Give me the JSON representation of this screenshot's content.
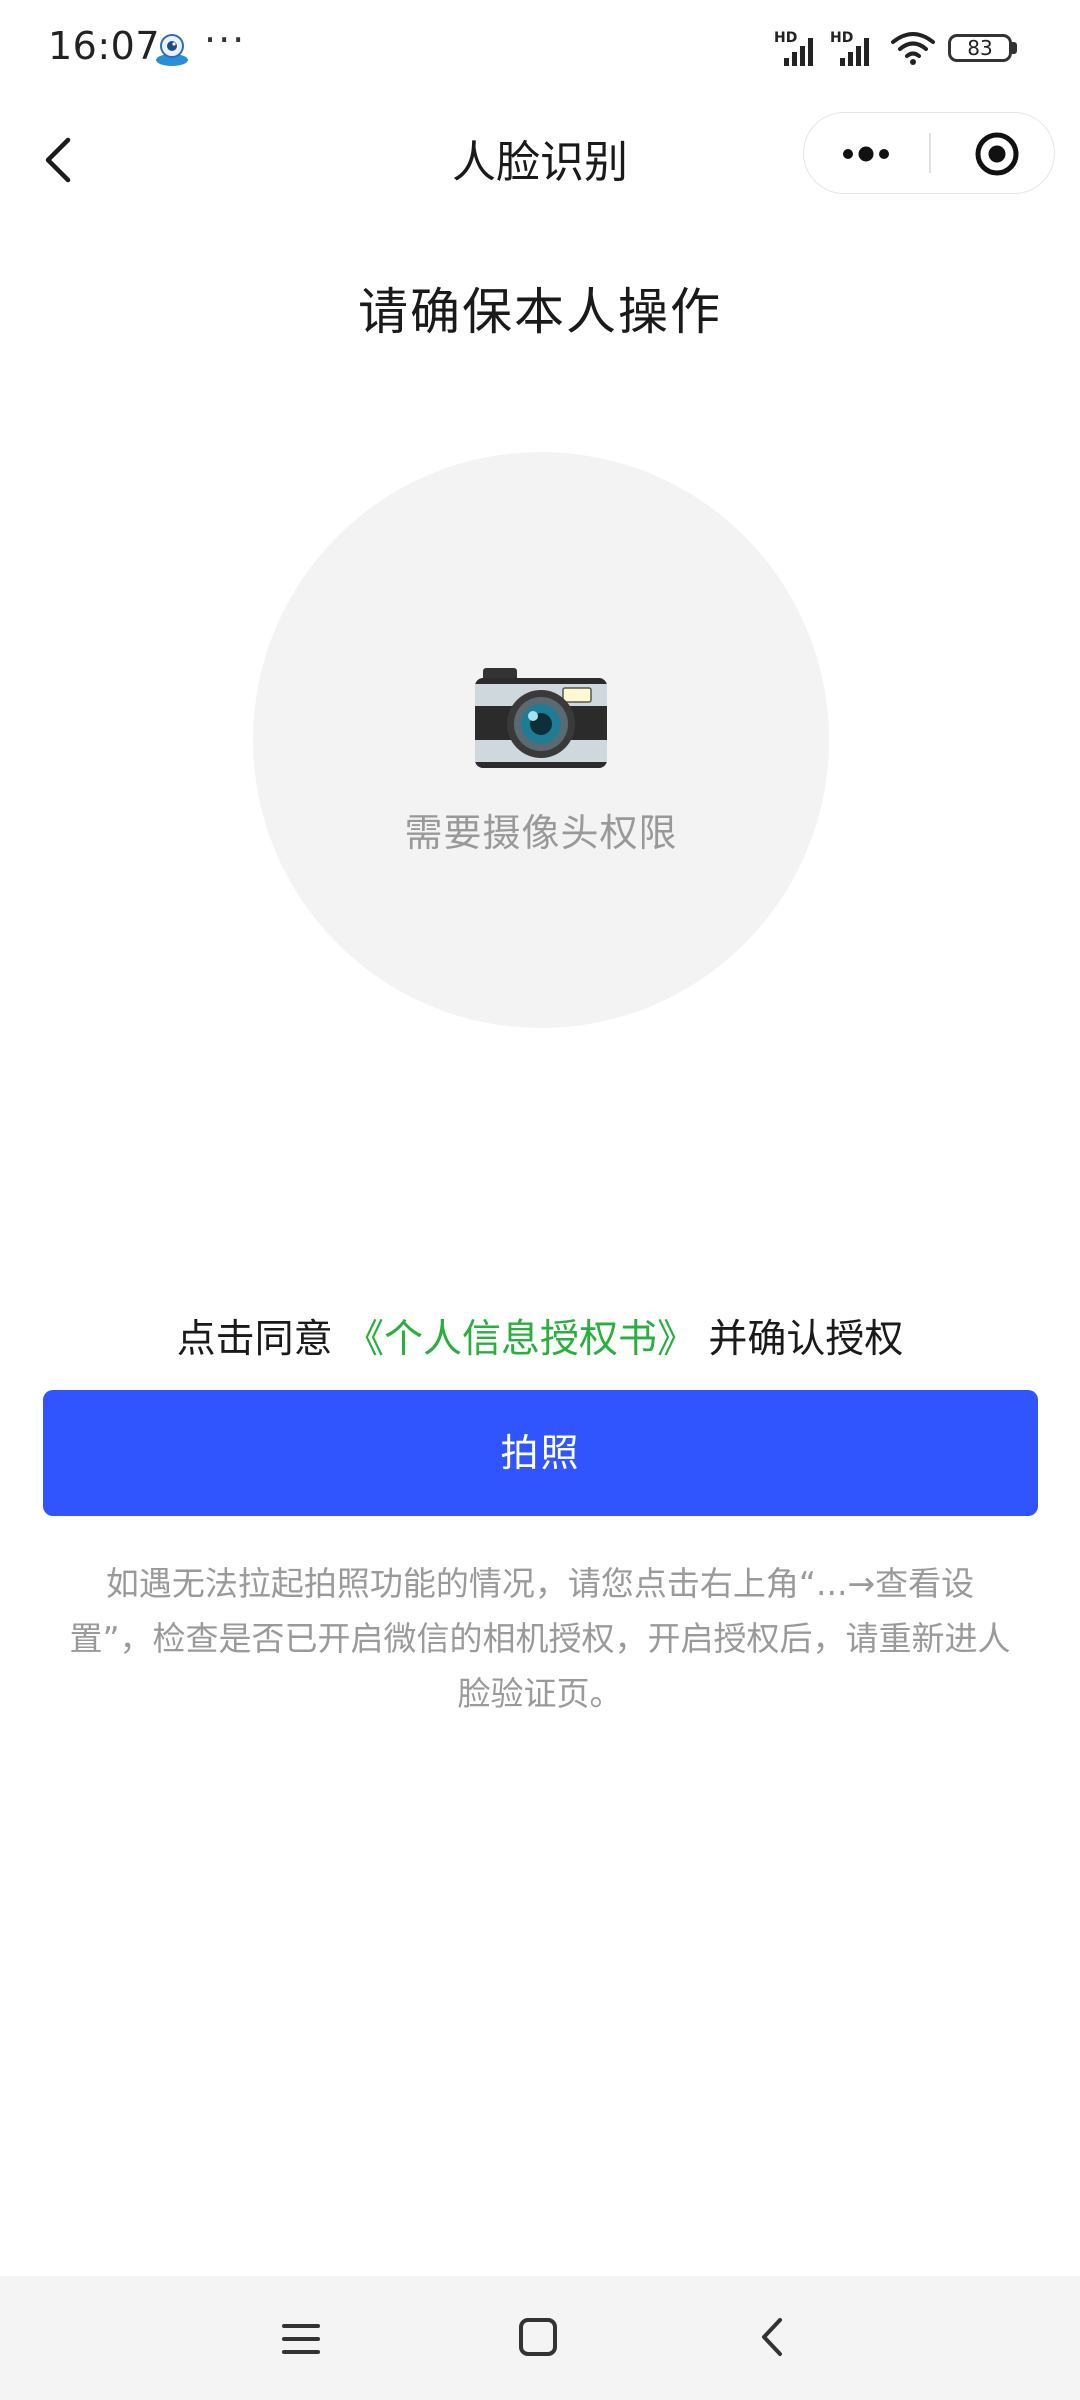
{
  "status_bar": {
    "time": "16:07",
    "more_dots": "···",
    "hd_label": "HD",
    "battery_level": "83"
  },
  "nav": {
    "title": "人脸识别"
  },
  "main": {
    "heading": "请确保本人操作",
    "camera_hint": "需要摄像头权限",
    "consent_prefix": "点击同意",
    "consent_link": "《个人信息授权书》",
    "consent_suffix": "并确认授权",
    "photo_button_label": "拍照",
    "help_text": "如遇无法拉起拍照功能的情况，请您点击右上角“...→查看设置”，检查是否已开启微信的相机授权，开启授权后，请重新进人脸验证页。"
  },
  "colors": {
    "primary_button": "#3054fd",
    "link": "#2aae3d",
    "hint_text": "#999999",
    "circle_bg": "#f3f3f3"
  },
  "icons": {
    "back": "chevron-left-icon",
    "capsule_more": "more-dots-icon",
    "capsule_close": "target-close-icon",
    "camera": "camera-icon",
    "system_menu": "menu-lines-icon",
    "system_home": "home-square-icon",
    "system_back": "back-chevron-icon"
  }
}
